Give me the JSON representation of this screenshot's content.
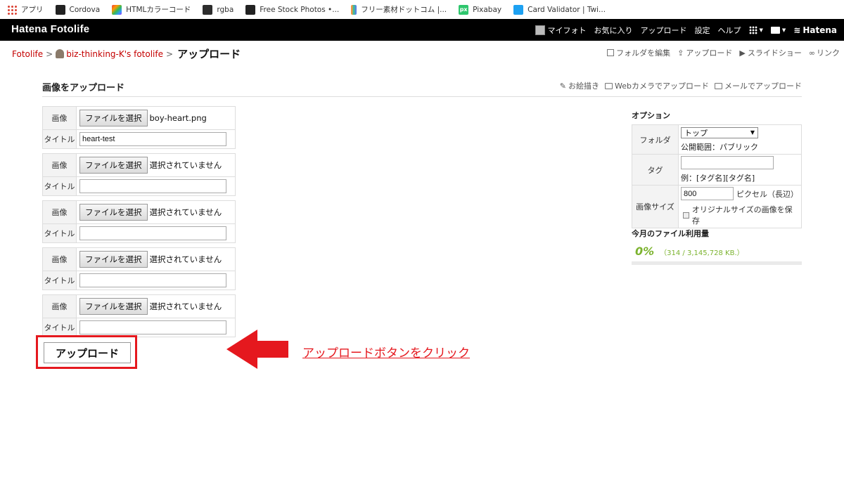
{
  "bookmarks": [
    {
      "label": "アプリ",
      "icon": "apps-grid-icon"
    },
    {
      "label": "Cordova",
      "icon": "github-icon"
    },
    {
      "label": "HTMLカラーコード",
      "icon": "html-color-icon"
    },
    {
      "label": "rgba",
      "icon": "rgba-icon"
    },
    {
      "label": "Free Stock Photos •...",
      "icon": "github-icon"
    },
    {
      "label": "フリー素材ドットコム |...",
      "icon": "free-material-icon"
    },
    {
      "label": "Pixabay",
      "icon": "pixabay-icon"
    },
    {
      "label": "Card Validator | Twi...",
      "icon": "twitter-icon"
    }
  ],
  "header": {
    "logo": "Hatena Fotolife",
    "nav": {
      "myfoto": "マイフォト",
      "favorites": "お気に入り",
      "upload": "アップロード",
      "settings": "設定",
      "help": "ヘルプ",
      "hatena": "Hatena"
    }
  },
  "breadcrumb": {
    "root": "Fotolife",
    "user": "biz-thinking-K's fotolife",
    "current": "アップロード",
    "separator": ">"
  },
  "page_tools": {
    "edit_folder": "フォルダを編集",
    "upload": "アップロード",
    "slideshow": "スライドショー",
    "link": "リンク"
  },
  "main": {
    "title": "画像をアップロード",
    "sub_tools": {
      "draw": "お絵描き",
      "webcam": "Webカメラでアップロード",
      "email": "メールでアップロード"
    },
    "image_label": "画像",
    "title_label": "タイトル",
    "file_button": "ファイルを選択",
    "rows": [
      {
        "file_status": "boy-heart.png",
        "title_value": "heart-test"
      },
      {
        "file_status": "選択されていません",
        "title_value": ""
      },
      {
        "file_status": "選択されていません",
        "title_value": ""
      },
      {
        "file_status": "選択されていません",
        "title_value": ""
      },
      {
        "file_status": "選択されていません",
        "title_value": ""
      }
    ],
    "submit_label": "アップロード",
    "annotation": "アップロードボタンをクリック"
  },
  "sidebar": {
    "options_title": "オプション",
    "folder_label": "フォルダ",
    "folder_value": "トップ",
    "folder_visibility": "公開範囲：パブリック",
    "tag_label": "タグ",
    "tag_value": "",
    "tag_hint": "例：[タグ名][タグ名]",
    "size_label": "画像サイズ",
    "size_value": "800",
    "size_unit": "ピクセル（長辺）",
    "keep_original": "オリジナルサイズの画像を保存",
    "usage_title": "今月のファイル利用量",
    "usage_percent": "0%",
    "usage_detail": "（314 / 3,145,728 KB.）",
    "usage_fraction": 0.0001
  },
  "colors": {
    "accent_red": "#e5181e",
    "link_red": "#c40000",
    "usage_green": "#7cb32f",
    "header_bg": "#000000"
  }
}
